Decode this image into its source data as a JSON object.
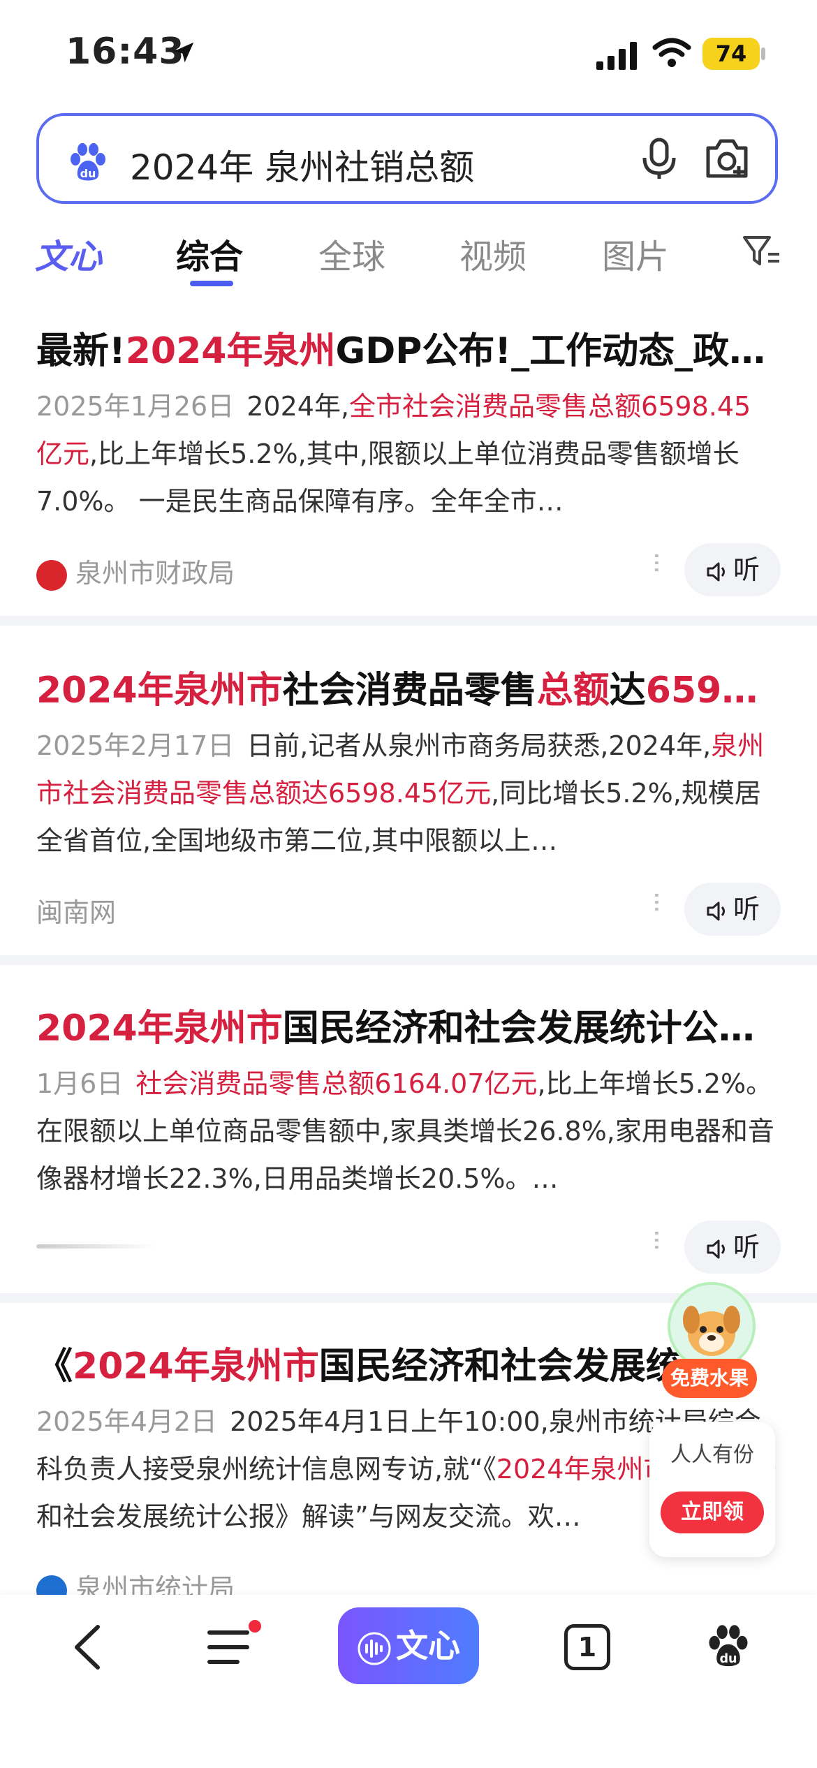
{
  "status_bar": {
    "time": "16:43",
    "battery": "74"
  },
  "search": {
    "query": "2024年 泉州社销总额"
  },
  "tabs": [
    {
      "label": "文心"
    },
    {
      "label": "综合"
    },
    {
      "label": "全球"
    },
    {
      "label": "视频"
    },
    {
      "label": "图片"
    }
  ],
  "results": [
    {
      "title_prefix": "最新!",
      "title_hl": "2024年泉州",
      "title_rest": "GDP公布!_工作动态_政…",
      "date": "2025年1月26日",
      "body_pre": "2024年,",
      "body_hl": "全市社会消费品零售总额6598.45亿元",
      "body_post": ",比上年增长5.2%,其中,限额以上单位消费品零售额增长7.0%。 一是民生商品保障有序。全年全市…",
      "source": "泉州市财政局",
      "listen": "听"
    },
    {
      "title_hl": "2024年泉州市",
      "title_mid": "社会消费品零售",
      "title_hl2": "总额",
      "title_mid2": "达",
      "title_hl3": "659…",
      "date": "2025年2月17日",
      "body_pre": "日前,记者从泉州市商务局获悉,2024年,",
      "body_hl": "泉州市社会消费品零售总额达6598.45亿元",
      "body_post": ",同比增长5.2%,规模居全省首位,全国地级市第二位,其中限额以上…",
      "source": "闽南网",
      "listen": "听"
    },
    {
      "title_hl": "2024年泉州市",
      "title_rest": "国民经济和社会发展统计公…",
      "date": "1月6日",
      "body_hl": "社会消费品零售总额6164.07亿元",
      "body_post": ",比上年增长5.2%。在限额以上单位商品零售额中,家具类增长26.8%,家用电器和音像器材增长22.3%,日用品类增长20.5%。…",
      "listen": "听"
    },
    {
      "title_prefix": "《",
      "title_hl": "2024年泉州市",
      "title_rest": "国民经济和社会发展统…",
      "date": "2025年4月2日",
      "body_pre": "2025年4月1日上午10:00,泉州市统计局综合科负责人接受泉州统计信息网专访,就“《",
      "body_hl": "2024年泉州市",
      "body_post": "国民经济和社会发展统计公报》解读”与网友交流。欢…",
      "source": "泉州市统计局"
    }
  ],
  "float": {
    "fruit_label": "免费水果",
    "gift_text": "人人有份",
    "gift_button": "立即领"
  },
  "bottom_nav": {
    "wenxin_label": "文心",
    "tab_count": "1"
  },
  "colors": {
    "accent": "#4c5bf0",
    "highlight": "#d6203f",
    "badge": "#ff5a2c"
  }
}
